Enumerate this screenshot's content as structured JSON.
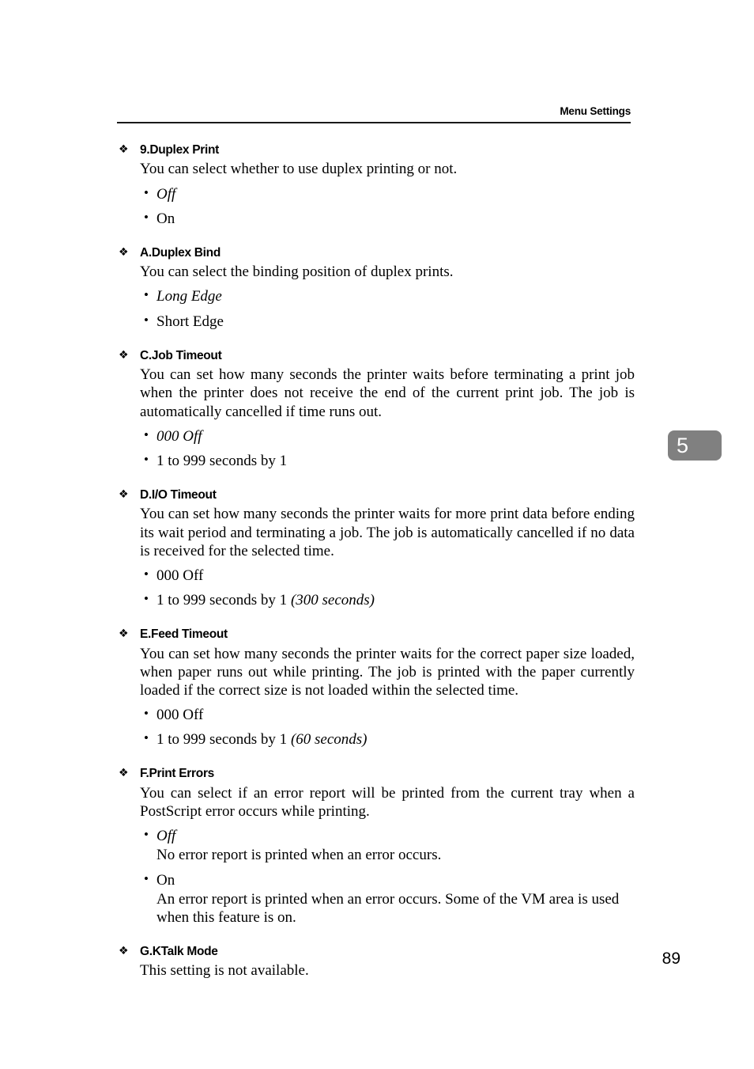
{
  "header": {
    "title": "Menu Settings"
  },
  "chapter_tab": {
    "number": "5",
    "background_color": "#808080",
    "text_color": "#ffffff"
  },
  "footer": {
    "page_number": "89"
  },
  "bullet_glyphs": {
    "section": "❖",
    "option": "•"
  },
  "sections": [
    {
      "heading": "9.Duplex Print",
      "description": "You can select whether to use duplex printing or not.",
      "options": [
        {
          "label": "Off",
          "italic": true,
          "detail": ""
        },
        {
          "label": "On",
          "italic": false,
          "detail": ""
        }
      ]
    },
    {
      "heading": "A.Duplex Bind",
      "description": "You can select the binding position of duplex prints.",
      "options": [
        {
          "label": "Long Edge",
          "italic": true,
          "detail": ""
        },
        {
          "label": "Short Edge",
          "italic": false,
          "detail": ""
        }
      ]
    },
    {
      "heading": "C.Job Timeout",
      "description": "You can set how many seconds the printer waits before terminating a print job when the printer does not receive the end of the current print job. The job is automatically cancelled if time runs out.",
      "options": [
        {
          "label": "000 Off",
          "italic": true,
          "detail": ""
        },
        {
          "label": "1 to 999 seconds by 1",
          "italic": false,
          "detail": ""
        }
      ]
    },
    {
      "heading": "D.I/O Timeout",
      "description": "You can set how many seconds the printer waits for more print data before ending its wait period and terminating a job. The job is automatically cancelled if no data is received for the selected time.",
      "options": [
        {
          "label": "000 Off",
          "italic": false,
          "detail": ""
        },
        {
          "label": "1 to 999 seconds by 1",
          "italic": false,
          "suffix_italic": "(300 seconds)",
          "detail": ""
        }
      ]
    },
    {
      "heading": "E.Feed Timeout",
      "description": "You can set how many seconds the printer waits for the correct paper size loaded, when paper runs out while printing. The job is printed with the paper currently loaded if the correct size is not loaded within the selected time.",
      "options": [
        {
          "label": "000 Off",
          "italic": false,
          "detail": ""
        },
        {
          "label": "1 to 999 seconds by 1",
          "italic": false,
          "suffix_italic": "(60 seconds)",
          "detail": ""
        }
      ]
    },
    {
      "heading": "F.Print Errors",
      "description": "You can select if an error report will be printed from the current tray when a PostScript error occurs while printing.",
      "options": [
        {
          "label": "Off",
          "italic": true,
          "detail": "No error report is printed when an error occurs."
        },
        {
          "label": "On",
          "italic": false,
          "detail": "An error report is printed when an error occurs. Some of the VM area is used when this feature is on."
        }
      ]
    },
    {
      "heading": "G.KTalk Mode",
      "description": "This setting is not available.",
      "options": []
    }
  ]
}
